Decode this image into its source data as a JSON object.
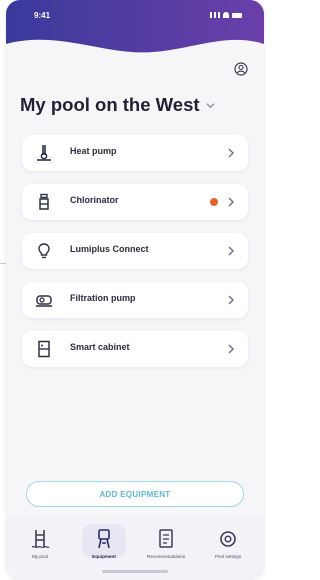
{
  "status_bar": {
    "time": "9:41"
  },
  "header": {
    "pool_name": "My pool on the West"
  },
  "equipment": [
    {
      "label": "Heat pump",
      "icon": "heat-pump-icon",
      "alert": false
    },
    {
      "label": "Chlorinator",
      "icon": "chlorinator-icon",
      "alert": true
    },
    {
      "label": "Lumiplus Connect",
      "icon": "light-bulb-icon",
      "alert": false
    },
    {
      "label": "Filtration pump",
      "icon": "filtration-pump-icon",
      "alert": false
    },
    {
      "label": "Smart cabinet",
      "icon": "cabinet-icon",
      "alert": false
    }
  ],
  "add_button": {
    "label": "ADD EQUIPMENT"
  },
  "nav": [
    {
      "label": "My pool",
      "icon": "pool-ladder-icon",
      "active": false
    },
    {
      "label": "Equipment",
      "icon": "equipment-icon",
      "active": true
    },
    {
      "label": "Recommendations",
      "icon": "document-icon",
      "active": false
    },
    {
      "label": "Pool settings",
      "icon": "settings-icon",
      "active": false
    }
  ],
  "colors": {
    "header_top": "#3d3a9a",
    "header_bottom": "#6a3fa8",
    "alert_dot": "#e2642a",
    "accent_cyan": "#5cb7d6",
    "text_dark": "#1f2233"
  }
}
